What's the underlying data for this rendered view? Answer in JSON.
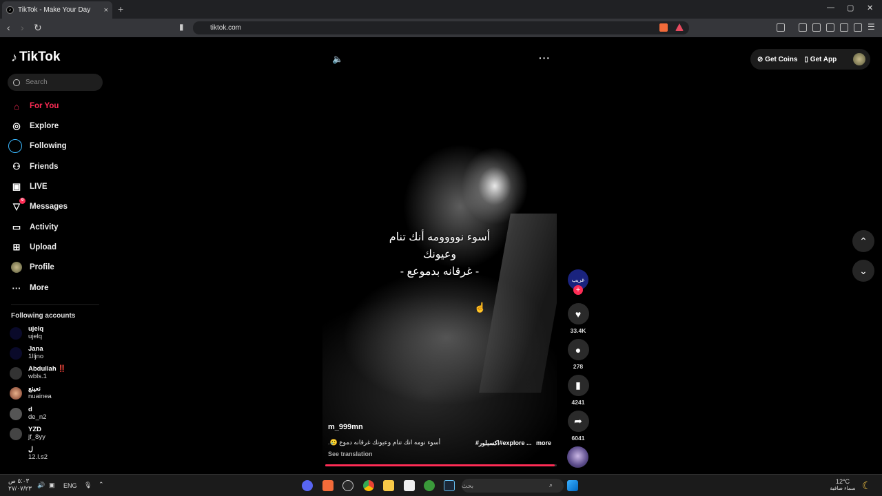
{
  "browser": {
    "tab_title": "TikTok - Make Your Day",
    "tab_close": "×",
    "new_tab": "+",
    "url": "tiktok.com",
    "back": "‹",
    "forward": "›",
    "reload": "↻"
  },
  "sidebar": {
    "logo": "TikTok",
    "search_placeholder": "Search",
    "nav": [
      {
        "label": "For You",
        "icon": "home-icon",
        "active": true
      },
      {
        "label": "Explore",
        "icon": "compass-icon"
      },
      {
        "label": "Following",
        "icon": "following-icon"
      },
      {
        "label": "Friends",
        "icon": "friends-icon"
      },
      {
        "label": "LIVE",
        "icon": "live-icon"
      },
      {
        "label": "Messages",
        "icon": "messages-icon",
        "badge": "9"
      },
      {
        "label": "Activity",
        "icon": "activity-icon"
      },
      {
        "label": "Upload",
        "icon": "upload-icon"
      },
      {
        "label": "Profile",
        "icon": "profile-icon"
      },
      {
        "label": "More",
        "icon": "more-icon"
      }
    ],
    "following_title": "Following accounts",
    "accounts": [
      {
        "name": "ujelq",
        "handle": "ujelq"
      },
      {
        "name": "Jana",
        "handle": "1lljno"
      },
      {
        "name": "Abdullah ‼️",
        "handle": "wbls.1"
      },
      {
        "name": "نعينع",
        "handle": "nuainea"
      },
      {
        "name": "d",
        "handle": "de_n2"
      },
      {
        "name": "YZD",
        "handle": "jf_8yy"
      },
      {
        "name": "ل",
        "handle": "12.l.s2"
      }
    ]
  },
  "video": {
    "caption_lines": [
      "أسوء نوووومه أنك تنام",
      "وعيونك",
      "- غرقانه بدموعع -"
    ],
    "author": "m_999mn",
    "description": "أسوء نومه انك تنام وعيونك غرقانه دموع 🥲.",
    "tags": "#اكسبلور#explore ...",
    "more": "more",
    "see_translation": "See translation",
    "progress": 0.99
  },
  "actions": {
    "creator_avatar_text": "غريب",
    "likes": "33.4K",
    "comments": "278",
    "saves": "4241",
    "shares": "6041"
  },
  "header": {
    "get_coins": "Get Coins",
    "get_app": "Get App"
  },
  "taskbar": {
    "time": "٥:٠٣ ص",
    "date": "٢٧/٠٧/٢٣",
    "lang": "ENG",
    "search_placeholder": "بحث",
    "weather_temp": "12°C",
    "weather_desc": "سماء صافية"
  },
  "colors": {
    "accent": "#fe2c55",
    "background": "#000000"
  }
}
